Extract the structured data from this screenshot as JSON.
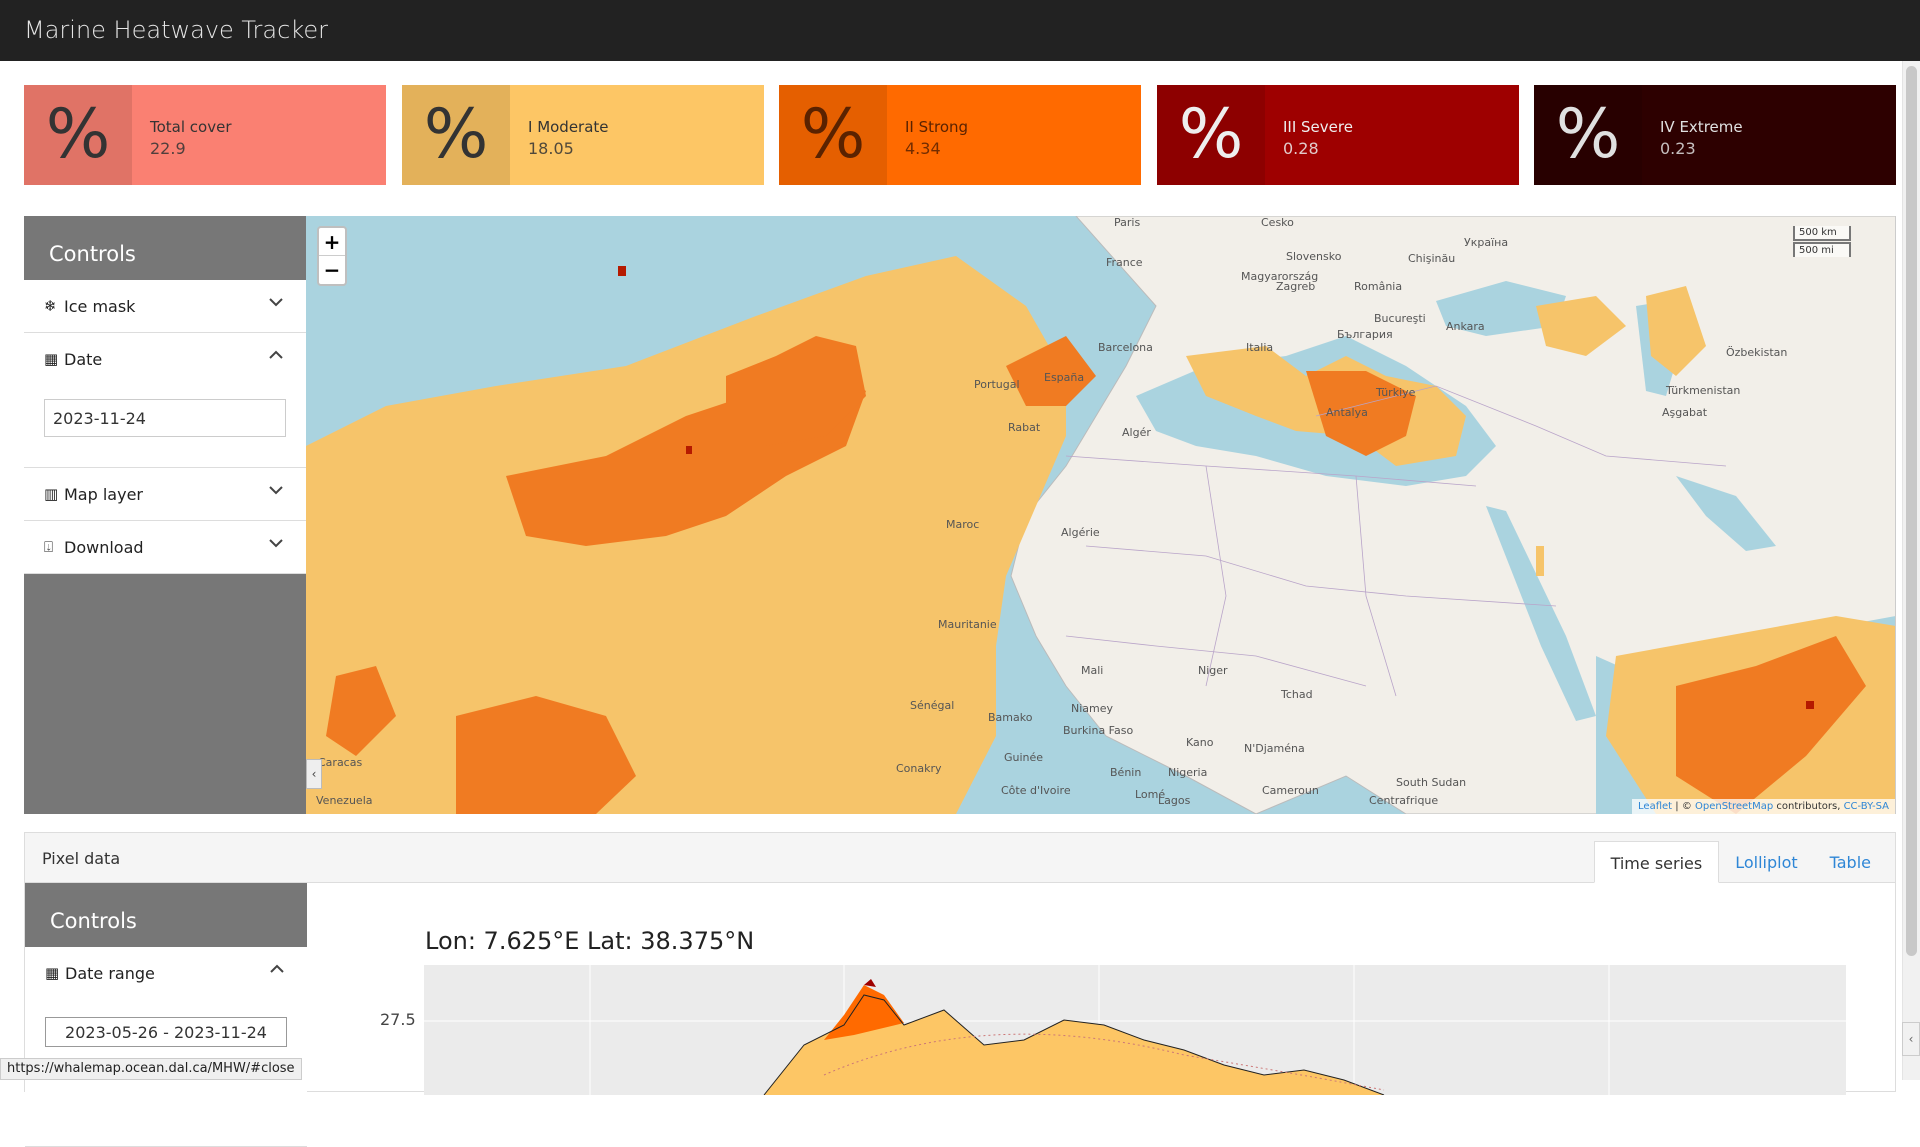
{
  "app": {
    "title": "Marine Heatwave Tracker"
  },
  "value_boxes": [
    {
      "title": "Total cover",
      "value": "22.9",
      "icon": "percent-icon",
      "bg": "#fa8072",
      "fg": "#333333"
    },
    {
      "title": "I Moderate",
      "value": "18.05",
      "icon": "percent-icon",
      "bg": "#fdc665",
      "fg": "#333333"
    },
    {
      "title": "II Strong",
      "value": "4.34",
      "icon": "percent-icon",
      "bg": "#ff6a00",
      "fg": "#5a2200"
    },
    {
      "title": "III Severe",
      "value": "0.28",
      "icon": "percent-icon",
      "bg": "#9e0000",
      "fg": "#eeeeee"
    },
    {
      "title": "IV Extreme",
      "value": "0.23",
      "icon": "percent-icon",
      "bg": "#2d0000",
      "fg": "#e0e0e0"
    }
  ],
  "controls": {
    "heading": "Controls",
    "ice_mask": "Ice mask",
    "date": {
      "label": "Date",
      "value": "2023-11-24"
    },
    "map_layer": "Map layer",
    "download": "Download"
  },
  "map": {
    "zoom_in": "+",
    "zoom_out": "−",
    "scale_km": "500 km",
    "scale_mi": "500 mi",
    "attribution": {
      "leaflet": "Leaflet",
      "sep": " | © ",
      "osm": "OpenStreetMap",
      "contrib": " contributors, ",
      "license": "CC-BY-SA"
    },
    "labels": [
      "Paris",
      "France",
      "Barcelona",
      "España",
      "Italia",
      "Algérie",
      "Maroc",
      "Mauritanie",
      "Mali",
      "Niger",
      "Tchad",
      "Sénégal",
      "Bamako",
      "Niamey",
      "Nigeria",
      "Cameroun",
      "Türkiye",
      "Antalya",
      "Ankara",
      "Slovensko",
      "Magyarország",
      "România",
      "България",
      "Bucureşti",
      "Zagreb",
      "Chişinău",
      "Україна",
      "Türkmenistan",
      "Özbekistan",
      "Aşgabat",
      "Centrafrique",
      "South Sudan",
      "Venezuela",
      "Caracas",
      "Guinée",
      "Côte d'Ivoire",
      "Bénin",
      "Lomé",
      "Lagos",
      "Kano",
      "N'Djaména",
      "Conakry",
      "Burkina Faso",
      "Cesko",
      "Portugal",
      "Algér",
      "Rabat"
    ],
    "legend_colors": {
      "ocean": "#aad3df",
      "moderate": "#f6c46a",
      "strong": "#f07b22",
      "severe": "#b51a00",
      "extreme": "#400000"
    }
  },
  "pixel_data": {
    "title": "Pixel data",
    "tabs": [
      "Time series",
      "Lolliplot",
      "Table"
    ],
    "active_tab": "Time series",
    "controls_heading": "Controls",
    "date_range_label": "Date range",
    "date_range_value": "2023-05-26 - 2023-11-24",
    "plot_title": "Lon: 7.625°E    Lat: 38.375°N",
    "ytick": "27.5"
  },
  "status_bar": {
    "url": "https://whalemap.ocean.dal.ca/MHW/#close"
  }
}
